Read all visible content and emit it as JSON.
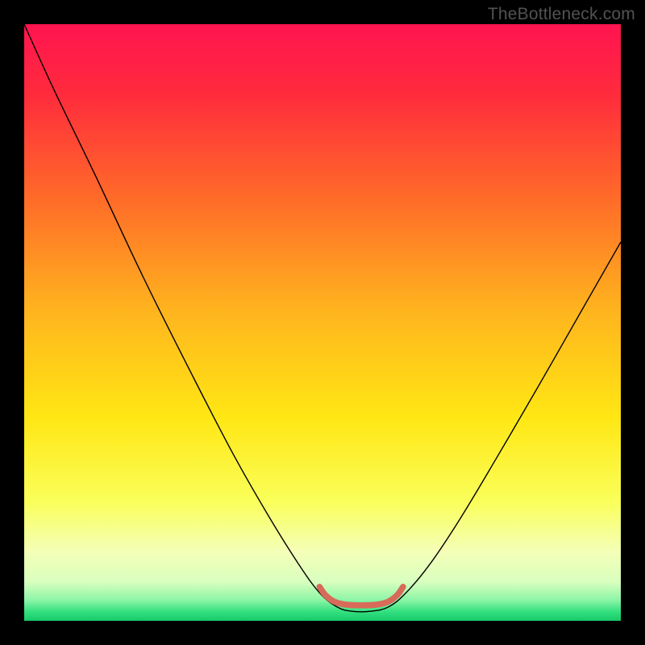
{
  "watermark": "TheBottleneck.com",
  "chart_data": {
    "type": "line",
    "title": "",
    "xlabel": "",
    "ylabel": "",
    "xlim": [
      0,
      100
    ],
    "ylim": [
      0,
      100
    ],
    "background_gradient": {
      "stops": [
        {
          "offset": 0.0,
          "color": "#ff1450"
        },
        {
          "offset": 0.12,
          "color": "#ff2c3c"
        },
        {
          "offset": 0.3,
          "color": "#ff6e28"
        },
        {
          "offset": 0.48,
          "color": "#ffb41e"
        },
        {
          "offset": 0.66,
          "color": "#ffe714"
        },
        {
          "offset": 0.8,
          "color": "#faff5a"
        },
        {
          "offset": 0.885,
          "color": "#f4ffb8"
        },
        {
          "offset": 0.935,
          "color": "#d8ffbe"
        },
        {
          "offset": 0.965,
          "color": "#8cf5a6"
        },
        {
          "offset": 0.985,
          "color": "#32e07e"
        },
        {
          "offset": 1.0,
          "color": "#18c86a"
        }
      ]
    },
    "series": [
      {
        "name": "bottleneck-curve",
        "color": "#000000",
        "width": 1.4,
        "points": [
          {
            "x": 0.0,
            "y": 100.0
          },
          {
            "x": 5.0,
            "y": 89.0
          },
          {
            "x": 12.0,
            "y": 74.5
          },
          {
            "x": 20.0,
            "y": 57.5
          },
          {
            "x": 28.0,
            "y": 41.5
          },
          {
            "x": 35.0,
            "y": 28.0
          },
          {
            "x": 41.0,
            "y": 17.5
          },
          {
            "x": 46.0,
            "y": 9.5
          },
          {
            "x": 49.5,
            "y": 4.7
          },
          {
            "x": 52.5,
            "y": 2.3
          },
          {
            "x": 55.0,
            "y": 1.6
          },
          {
            "x": 58.0,
            "y": 1.6
          },
          {
            "x": 61.0,
            "y": 2.3
          },
          {
            "x": 64.0,
            "y": 4.7
          },
          {
            "x": 68.0,
            "y": 9.5
          },
          {
            "x": 73.0,
            "y": 17.0
          },
          {
            "x": 79.0,
            "y": 27.0
          },
          {
            "x": 86.0,
            "y": 39.0
          },
          {
            "x": 94.0,
            "y": 53.0
          },
          {
            "x": 100.0,
            "y": 63.5
          }
        ]
      },
      {
        "name": "optimal-zone-marker",
        "color": "#d86a5a",
        "width": 7.5,
        "linecap": "round",
        "points": [
          {
            "x": 49.5,
            "y": 5.7
          },
          {
            "x": 50.5,
            "y": 4.3
          },
          {
            "x": 52.0,
            "y": 3.2
          },
          {
            "x": 54.0,
            "y": 2.7
          },
          {
            "x": 56.5,
            "y": 2.6
          },
          {
            "x": 59.0,
            "y": 2.7
          },
          {
            "x": 61.0,
            "y": 3.2
          },
          {
            "x": 62.5,
            "y": 4.3
          },
          {
            "x": 63.5,
            "y": 5.7
          }
        ]
      }
    ]
  }
}
